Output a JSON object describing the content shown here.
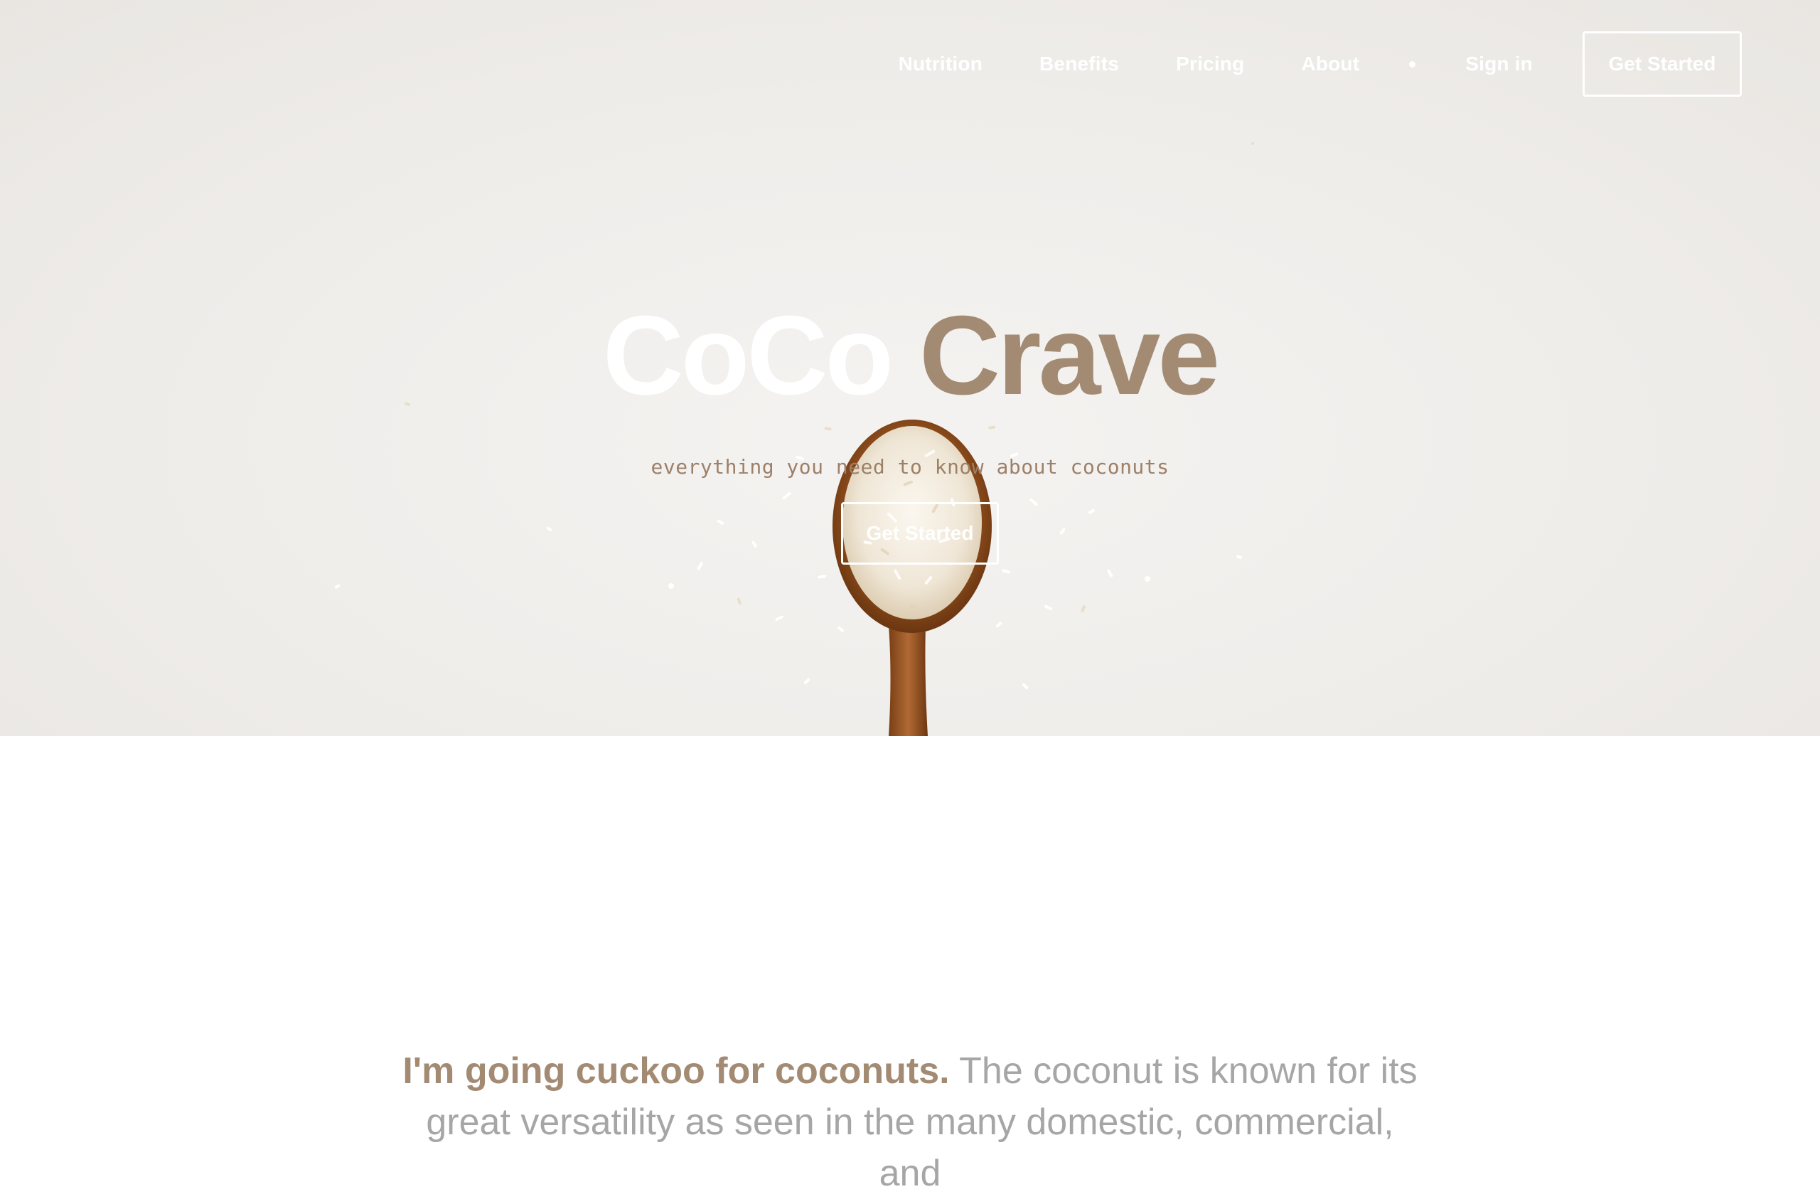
{
  "nav": {
    "links": [
      "Nutrition",
      "Benefits",
      "Pricing",
      "About"
    ],
    "signin_label": "Sign in",
    "cta_label": "Get Started"
  },
  "hero": {
    "title_part1": "CoCo",
    "title_part2": "Crave",
    "tagline": "everything you need to know about coconuts",
    "cta_label": "Get Started"
  },
  "intro": {
    "lead": "I'm going cuckoo for coconuts.",
    "body": " The coconut is known for its great versatility as seen in the many domestic, commercial, and"
  },
  "colors": {
    "accent": "#a38b73",
    "tagline": "#9d8068",
    "muted_text": "#a6a6a6",
    "hero_bg": "#efedea"
  },
  "icons": {
    "nav_separator": "dot-icon",
    "hero_image": "wooden-spoon-with-shredded-coconut"
  }
}
